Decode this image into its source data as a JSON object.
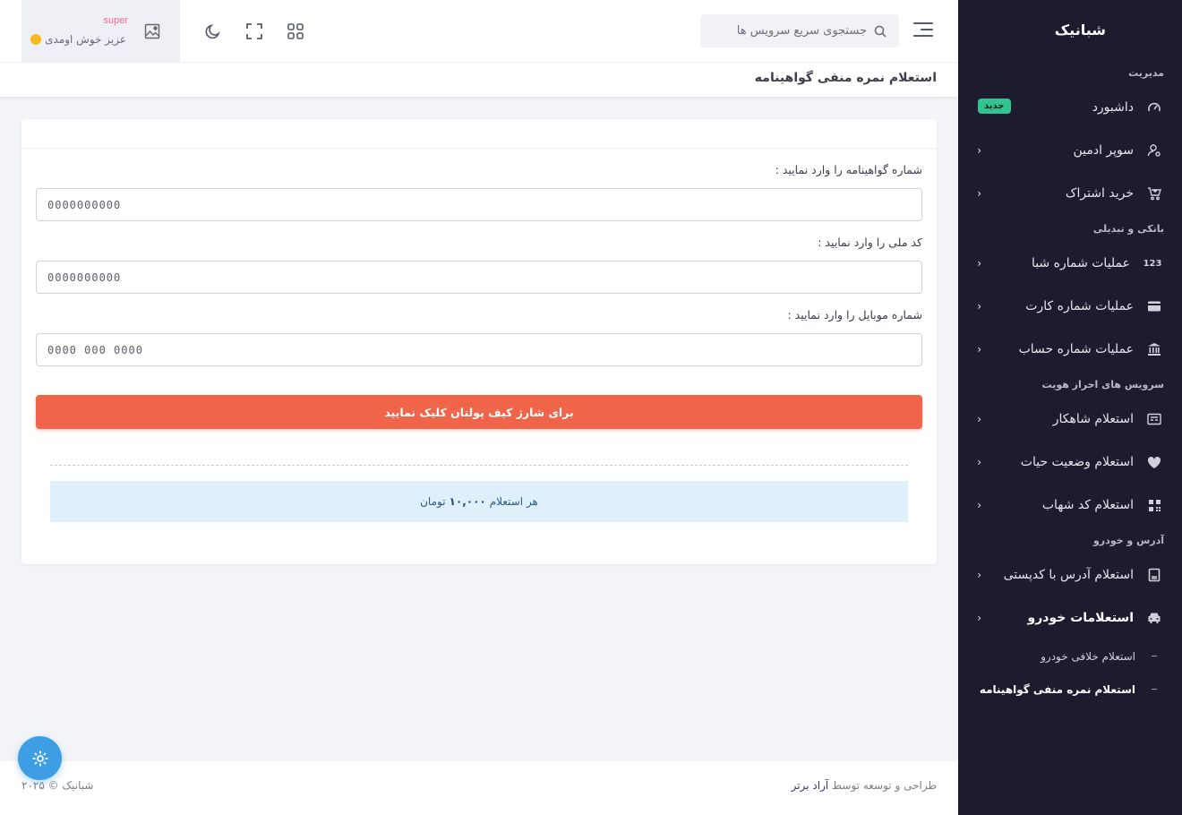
{
  "brand": {
    "name": "شبانیک"
  },
  "sidebar": {
    "sections": {
      "management": "مدیریت",
      "banking": "بانکی و تبدیلی",
      "identity": "سرویس های احراز هویت",
      "address_car": "آدرس و خودرو"
    },
    "items": {
      "dashboard": {
        "label": "داشبورد",
        "badge": "جدید",
        "icon": "gauge-icon"
      },
      "super_admin": {
        "label": "سوپر ادمین",
        "icon": "user-admin-icon"
      },
      "subscription": {
        "label": "خرید اشتراک",
        "icon": "cart-icon"
      },
      "sheba": {
        "label": "عملیات شماره شبا",
        "icon_text": "123"
      },
      "card": {
        "label": "عملیات شماره کارت",
        "icon": "credit-card-icon"
      },
      "account": {
        "label": "عملیات شماره حساب",
        "icon": "bank-icon"
      },
      "shahkar": {
        "label": "استعلام شاهکار",
        "icon": "id-card-icon"
      },
      "life": {
        "label": "استعلام وضعیت حیات",
        "icon": "heart-icon"
      },
      "shahab": {
        "label": "استعلام کد شهاب",
        "icon": "qr-icon"
      },
      "postal": {
        "label": "استعلام آدرس با کدپستی",
        "icon": "address-book-icon"
      },
      "car": {
        "label": "استعلامات خودرو",
        "icon": "car-icon"
      }
    },
    "sub_items": {
      "car_violations": "استعلام خلافی خودرو",
      "license_points": "استعلام نمره منفی گواهینامه"
    }
  },
  "topbar": {
    "search_placeholder": "جستجوی سریع سرویس ها",
    "user_name": "super",
    "greeting": "عزیز خوش اومدی"
  },
  "page": {
    "title": "استعلام نمره منفی گواهینامه"
  },
  "form": {
    "license_label": "شماره گواهینامه را وارد نمایید :",
    "license_placeholder": "0000000000",
    "national_label": "کد ملی را وارد نمایید :",
    "national_placeholder": "0000000000",
    "mobile_label": "شماره موبایل را وارد نمایید :",
    "mobile_placeholder": "0000 000 0000",
    "charge_button": "برای شارژ کیف پولتان کلیک نمایید",
    "price_prefix": "هر استعلام",
    "price_value": "۱۰,۰۰۰",
    "price_suffix": "تومان"
  },
  "footer": {
    "designed_by_prefix": "طراحی و توسعه توسط",
    "designer": "آراد برتر",
    "copyright": "شبانیک © ۲۰۲۵"
  },
  "colors": {
    "sidebar_bg": "#1d1c2e",
    "accent_orange": "#f0654a",
    "info_bg": "#dff0fa",
    "badge_green": "#34c38f",
    "fab_blue": "#3d9ee4"
  }
}
